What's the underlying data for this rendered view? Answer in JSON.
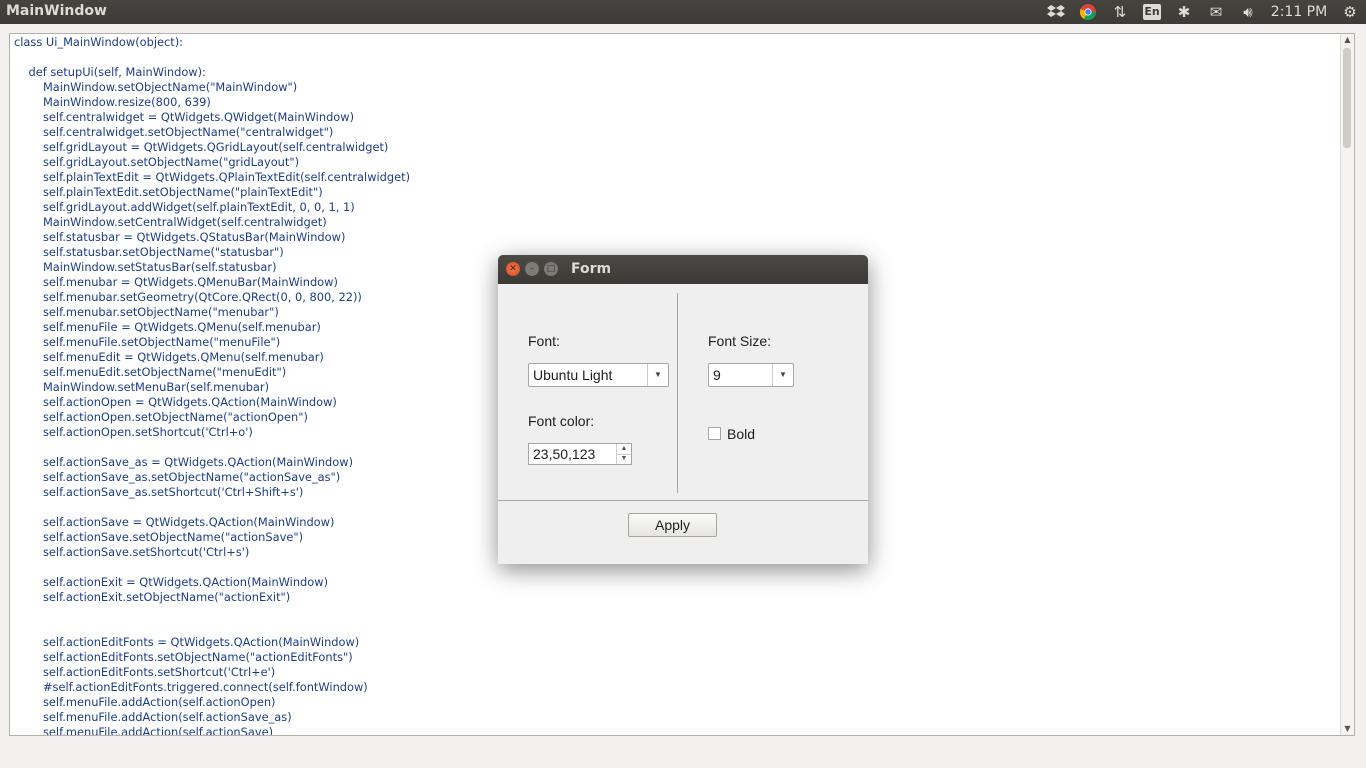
{
  "window": {
    "title": "MainWindow"
  },
  "tray": {
    "language": "En",
    "time": "2:11 PM"
  },
  "code_lines": [
    "class Ui_MainWindow(object):",
    "",
    "    def setupUi(self, MainWindow):",
    "        MainWindow.setObjectName(\"MainWindow\")",
    "        MainWindow.resize(800, 639)",
    "        self.centralwidget = QtWidgets.QWidget(MainWindow)",
    "        self.centralwidget.setObjectName(\"centralwidget\")",
    "        self.gridLayout = QtWidgets.QGridLayout(self.centralwidget)",
    "        self.gridLayout.setObjectName(\"gridLayout\")",
    "        self.plainTextEdit = QtWidgets.QPlainTextEdit(self.centralwidget)",
    "        self.plainTextEdit.setObjectName(\"plainTextEdit\")",
    "        self.gridLayout.addWidget(self.plainTextEdit, 0, 0, 1, 1)",
    "        MainWindow.setCentralWidget(self.centralwidget)",
    "        self.statusbar = QtWidgets.QStatusBar(MainWindow)",
    "        self.statusbar.setObjectName(\"statusbar\")",
    "        MainWindow.setStatusBar(self.statusbar)",
    "        self.menubar = QtWidgets.QMenuBar(MainWindow)",
    "        self.menubar.setGeometry(QtCore.QRect(0, 0, 800, 22))",
    "        self.menubar.setObjectName(\"menubar\")",
    "        self.menuFile = QtWidgets.QMenu(self.menubar)",
    "        self.menuFile.setObjectName(\"menuFile\")",
    "        self.menuEdit = QtWidgets.QMenu(self.menubar)",
    "        self.menuEdit.setObjectName(\"menuEdit\")",
    "        MainWindow.setMenuBar(self.menubar)",
    "        self.actionOpen = QtWidgets.QAction(MainWindow)",
    "        self.actionOpen.setObjectName(\"actionOpen\")",
    "        self.actionOpen.setShortcut('Ctrl+o')",
    "",
    "        self.actionSave_as = QtWidgets.QAction(MainWindow)",
    "        self.actionSave_as.setObjectName(\"actionSave_as\")",
    "        self.actionSave_as.setShortcut('Ctrl+Shift+s')",
    "",
    "        self.actionSave = QtWidgets.QAction(MainWindow)",
    "        self.actionSave.setObjectName(\"actionSave\")",
    "        self.actionSave.setShortcut('Ctrl+s')",
    "",
    "        self.actionExit = QtWidgets.QAction(MainWindow)",
    "        self.actionExit.setObjectName(\"actionExit\")",
    "",
    "",
    "        self.actionEditFonts = QtWidgets.QAction(MainWindow)",
    "        self.actionEditFonts.setObjectName(\"actionEditFonts\")",
    "        self.actionEditFonts.setShortcut('Ctrl+e')",
    "        #self.actionEditFonts.triggered.connect(self.fontWindow)",
    "        self.menuFile.addAction(self.actionOpen)",
    "        self.menuFile.addAction(self.actionSave_as)",
    "        self.menuFile.addAction(self.actionSave)"
  ],
  "dialog": {
    "title": "Form",
    "font_label": "Font:",
    "font_value": "Ubuntu Light",
    "font_size_label": "Font Size:",
    "font_size_value": "9",
    "font_color_label": "Font color:",
    "font_color_value": "23,50,123",
    "bold_label": "Bold",
    "bold_checked": false,
    "apply_label": "Apply"
  },
  "colors": {
    "code_text": "#1d3d8a",
    "panel_bg": "#3c3b37",
    "close_button": "#e95420"
  }
}
